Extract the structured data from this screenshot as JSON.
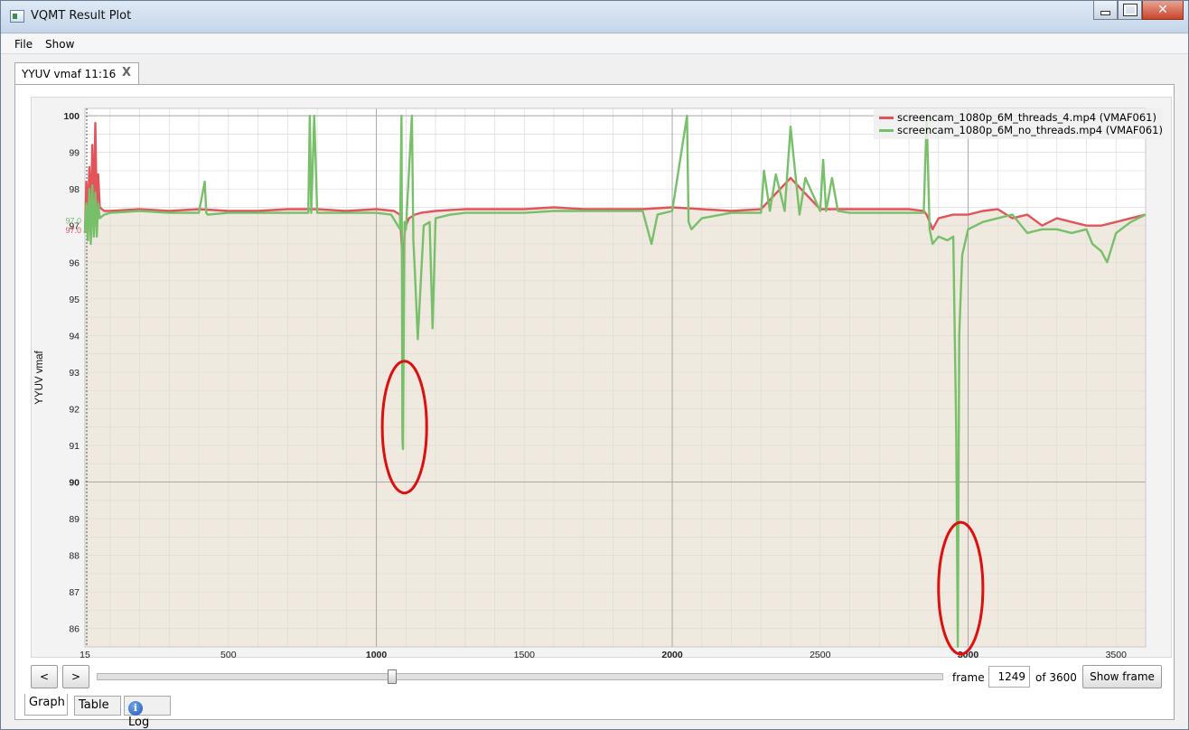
{
  "window": {
    "title": "VQMT Result Plot",
    "controls": [
      "minimize",
      "maximize",
      "close"
    ]
  },
  "menu": {
    "items": [
      "File",
      "Show"
    ]
  },
  "tab": {
    "label": "YYUV vmaf 11:16",
    "close_glyph": "X"
  },
  "controls": {
    "prev_label": "<",
    "next_label": ">",
    "frame_label": "frame",
    "frame_value": "1249",
    "of_label": "of 3600",
    "show_frame_label": "Show frame",
    "slider_position": 0.347
  },
  "bottom_tabs": [
    "Graph",
    "Table",
    "Log"
  ],
  "colors": {
    "series1": "#e0545a",
    "series2": "#77c069",
    "plot_fill": "#f0e9df",
    "annotation": "#dd1010"
  },
  "chart_data": {
    "type": "line",
    "ylabel": "YYUV vmaf",
    "xlabel": "",
    "xlim": [
      15,
      3600
    ],
    "ylim": [
      85.5,
      100.2
    ],
    "x_ticks": [
      "15",
      "500",
      "1000",
      "1500",
      "2000",
      "2500",
      "3000",
      "3500"
    ],
    "x_tick_values": [
      15,
      500,
      1000,
      1500,
      2000,
      2500,
      3000,
      3500
    ],
    "y_ticks": [
      100,
      99,
      98,
      97,
      96,
      95,
      94,
      93,
      92,
      91,
      90,
      89,
      88,
      87,
      86
    ],
    "marker_labels": [
      "97.0",
      "97.0"
    ],
    "legend_position": "top-right",
    "series": [
      {
        "name": "screencam_1080p_6M_threads_4.mp4 (VMAF061)",
        "color": "#e0545a",
        "x": [
          15,
          20,
          25,
          30,
          35,
          40,
          45,
          50,
          55,
          60,
          65,
          80,
          100,
          200,
          300,
          400,
          500,
          600,
          700,
          800,
          900,
          1000,
          1060,
          1080,
          1090,
          1095,
          1100,
          1110,
          1130,
          1150,
          1200,
          1300,
          1400,
          1500,
          1600,
          1700,
          1800,
          1900,
          2000,
          2100,
          2200,
          2300,
          2400,
          2500,
          2600,
          2700,
          2800,
          2850,
          2860,
          2880,
          2900,
          2950,
          3000,
          3050,
          3100,
          3150,
          3200,
          3250,
          3300,
          3350,
          3400,
          3450,
          3500,
          3550,
          3600
        ],
        "y": [
          96.8,
          98.2,
          97.2,
          98.6,
          97.1,
          99.2,
          97.3,
          99.8,
          97.4,
          98.4,
          97.5,
          97.4,
          97.4,
          97.45,
          97.4,
          97.45,
          97.4,
          97.4,
          97.45,
          97.45,
          97.4,
          97.45,
          97.4,
          97.3,
          95.8,
          96.8,
          97.0,
          97.2,
          97.3,
          97.35,
          97.4,
          97.45,
          97.45,
          97.45,
          97.5,
          97.45,
          97.45,
          97.45,
          97.5,
          97.45,
          97.4,
          97.45,
          98.3,
          97.45,
          97.45,
          97.45,
          97.45,
          97.4,
          97.3,
          96.9,
          97.2,
          97.3,
          97.3,
          97.4,
          97.45,
          97.2,
          97.3,
          97.0,
          97.2,
          97.1,
          97.0,
          97.0,
          97.1,
          97.2,
          97.3
        ]
      },
      {
        "name": "screencam_1080p_6M_no_threads.mp4 (VMAF061)",
        "color": "#77c069",
        "x": [
          15,
          20,
          25,
          30,
          35,
          40,
          45,
          50,
          55,
          60,
          65,
          80,
          100,
          200,
          300,
          400,
          420,
          425,
          430,
          500,
          600,
          700,
          770,
          775,
          780,
          790,
          800,
          900,
          1000,
          1050,
          1080,
          1085,
          1088,
          1090,
          1095,
          1100,
          1120,
          1125,
          1130,
          1140,
          1160,
          1180,
          1190,
          1200,
          1250,
          1300,
          1400,
          1500,
          1600,
          1700,
          1800,
          1900,
          1930,
          1950,
          2000,
          2050,
          2055,
          2065,
          2100,
          2200,
          2300,
          2310,
          2330,
          2350,
          2380,
          2400,
          2430,
          2450,
          2500,
          2510,
          2520,
          2540,
          2560,
          2600,
          2700,
          2800,
          2850,
          2860,
          2870,
          2880,
          2900,
          2930,
          2950,
          2960,
          2965,
          2970,
          2980,
          3000,
          3050,
          3100,
          3150,
          3200,
          3250,
          3300,
          3350,
          3400,
          3420,
          3450,
          3470,
          3500,
          3550,
          3600
        ],
        "y": [
          96.8,
          97.6,
          96.6,
          98.0,
          96.5,
          98.1,
          96.7,
          97.9,
          96.7,
          97.6,
          97.2,
          97.3,
          97.35,
          97.4,
          97.35,
          97.35,
          98.2,
          97.35,
          97.3,
          97.35,
          97.35,
          97.35,
          97.35,
          100,
          97.35,
          100,
          97.35,
          97.35,
          97.35,
          97.3,
          96.9,
          100,
          91.2,
          90.9,
          97.1,
          96.9,
          100,
          96.6,
          95.8,
          93.9,
          97.0,
          97.1,
          94.2,
          97.2,
          97.3,
          97.35,
          97.35,
          97.35,
          97.4,
          97.4,
          97.4,
          97.4,
          96.5,
          97.3,
          97.4,
          100,
          97.1,
          96.9,
          97.2,
          97.35,
          97.35,
          98.5,
          97.4,
          98.4,
          97.4,
          99.7,
          97.3,
          98.3,
          97.4,
          98.8,
          97.4,
          98.3,
          97.4,
          97.35,
          97.35,
          97.35,
          97.35,
          100,
          96.9,
          96.5,
          96.7,
          96.6,
          96.7,
          91.3,
          85.5,
          94.0,
          96.2,
          96.9,
          97.1,
          97.2,
          97.3,
          96.8,
          96.9,
          96.9,
          96.8,
          96.9,
          96.5,
          96.3,
          96.0,
          96.8,
          97.1,
          97.3
        ]
      }
    ],
    "annotations": [
      {
        "shape": "ellipse",
        "cx": 1095,
        "cy": 91.5,
        "rx": 75,
        "ry": 1.8
      },
      {
        "shape": "ellipse",
        "cx": 2975,
        "cy": 87.1,
        "rx": 75,
        "ry": 1.8
      }
    ]
  }
}
